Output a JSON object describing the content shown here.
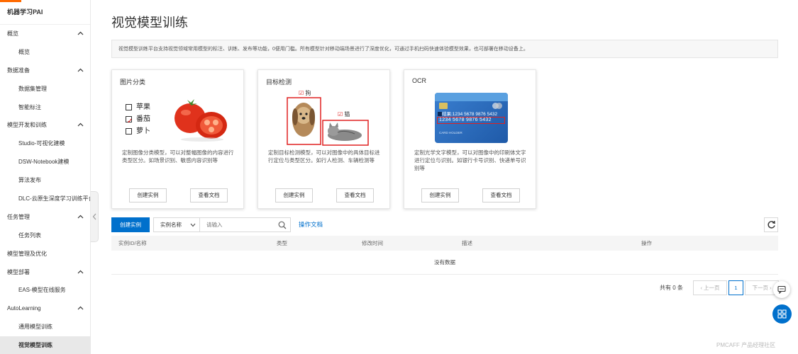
{
  "sidebar": {
    "brand": "机器学习PAI",
    "items": [
      {
        "label": "概览",
        "type": "group",
        "expanded": true
      },
      {
        "label": "概览",
        "type": "item"
      },
      {
        "label": "数据准备",
        "type": "group",
        "expanded": true
      },
      {
        "label": "数据集管理",
        "type": "item"
      },
      {
        "label": "智能标注",
        "type": "item"
      },
      {
        "label": "模型开发和训练",
        "type": "group",
        "expanded": true
      },
      {
        "label": "Studio-可视化建模",
        "type": "item"
      },
      {
        "label": "DSW-Notebook建模",
        "type": "item"
      },
      {
        "label": "算法发布",
        "type": "item"
      },
      {
        "label": "DLC-云原生深度学习训练平台",
        "type": "item"
      },
      {
        "label": "任务管理",
        "type": "group",
        "expanded": true
      },
      {
        "label": "任务列表",
        "type": "item"
      },
      {
        "label": "模型管理及优化",
        "type": "group",
        "expanded": false
      },
      {
        "label": "模型部署",
        "type": "group",
        "expanded": true
      },
      {
        "label": "EAS-模型在线服务",
        "type": "item"
      },
      {
        "label": "AutoLearning",
        "type": "group",
        "expanded": true
      },
      {
        "label": "通用模型训练",
        "type": "item"
      },
      {
        "label": "视觉模型训练",
        "type": "item",
        "active": true
      }
    ]
  },
  "main": {
    "title": "视觉模型训练",
    "description": "视觉模型训练平台支持视觉领域常用模型的标注、训练、发布等功能，0便用门槛。所有模型针对移动端场景进行了深度优化，可通过手机扫码快速体验模型效果，也可部署在移动设备上。",
    "cards": [
      {
        "title": "图片分类",
        "options": [
          "苹果",
          "番茄",
          "萝卜"
        ],
        "checked_index": 1,
        "description": "定制图像分类模型，可以对整幅图像的内容进行类型区分。如场景识别、敏感内容识别等",
        "create_label": "创建实例",
        "docs_label": "查看文档"
      },
      {
        "title": "目标检测",
        "labels": [
          "狗",
          "猫"
        ],
        "description": "定制目标检测模型，可以对图像中的具体目标进行定位与类型区分。如行人检测、车辆检测等",
        "create_label": "创建实例",
        "docs_label": "查看文档"
      },
      {
        "title": "OCR",
        "card_result": "结果:1234 5678 9876 5432",
        "card_number": "1234 5678 9876 5432",
        "card_holder": "CARD HOLDER",
        "description": "定制光学文字模型，可以对图像中的印刷体文字进行定位与识别。如银行卡号识别、快递单号识别等",
        "create_label": "创建实例",
        "docs_label": "查看文档"
      }
    ],
    "toolbar": {
      "create_label": "创建实例",
      "filter_select": "实例名称",
      "search_placeholder": "请输入",
      "doc_link": "操作文档"
    },
    "table": {
      "columns": [
        "实例ID/名称",
        "类型",
        "修改时间",
        "描述",
        "操作"
      ],
      "empty_text": "没有数据"
    },
    "pagination": {
      "total_text": "共有 0 条",
      "prev_label": "上一页",
      "current_page": "1",
      "next_label": "下一页"
    }
  },
  "watermark": "PMCAFF 产品经理社区",
  "colors": {
    "primary": "#0070cc",
    "brand": "#ff6a00",
    "highlight_red": "#e02020"
  }
}
